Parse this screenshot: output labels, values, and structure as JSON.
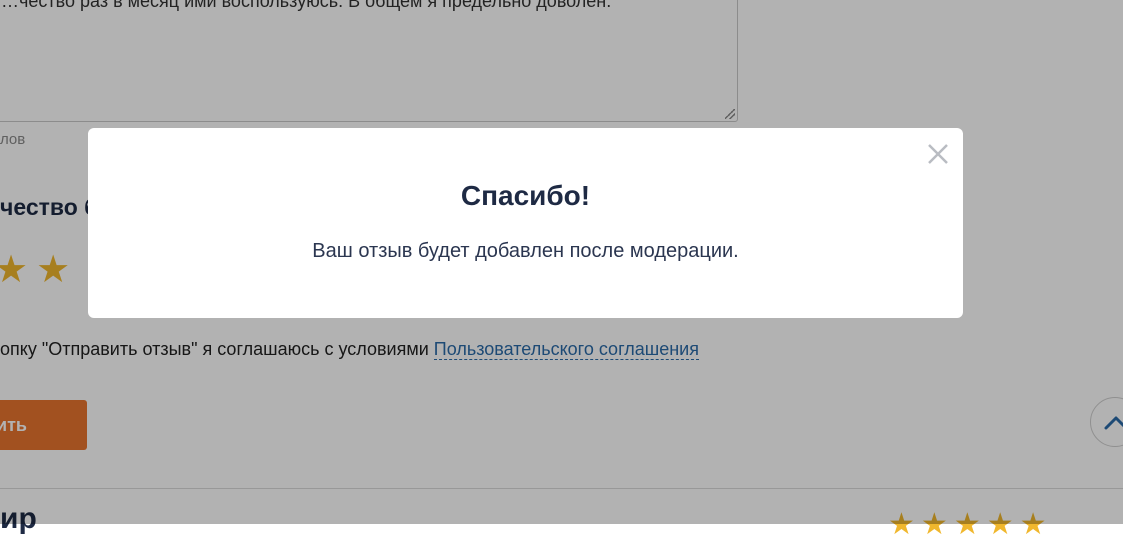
{
  "background": {
    "review_text": "…чество раз в месяц ими воспользуюсь. В общем я предельно доволен.",
    "char_counter": "лов",
    "quality_heading": "чество б",
    "stars": [
      "★",
      "★"
    ],
    "agreement_text": "опку \"Отправить отзыв\" я соглашаюсь с условиями ",
    "agreement_link": "Пользовательского соглашения",
    "submit_label": "ить",
    "next_title": "ир",
    "bottom_stars": [
      "★",
      "★",
      "★",
      "★",
      "★"
    ]
  },
  "modal": {
    "close_icon": "close-icon",
    "title": "Спасибо!",
    "message": "Ваш отзыв будет добавлен после модерации."
  },
  "scroll_top_icon": "chevron-up-icon",
  "colors": {
    "accent_orange": "#e8742f",
    "star_gold": "#f0b72d",
    "link_blue": "#2a6aa8",
    "heading_navy": "#1e2a44"
  }
}
